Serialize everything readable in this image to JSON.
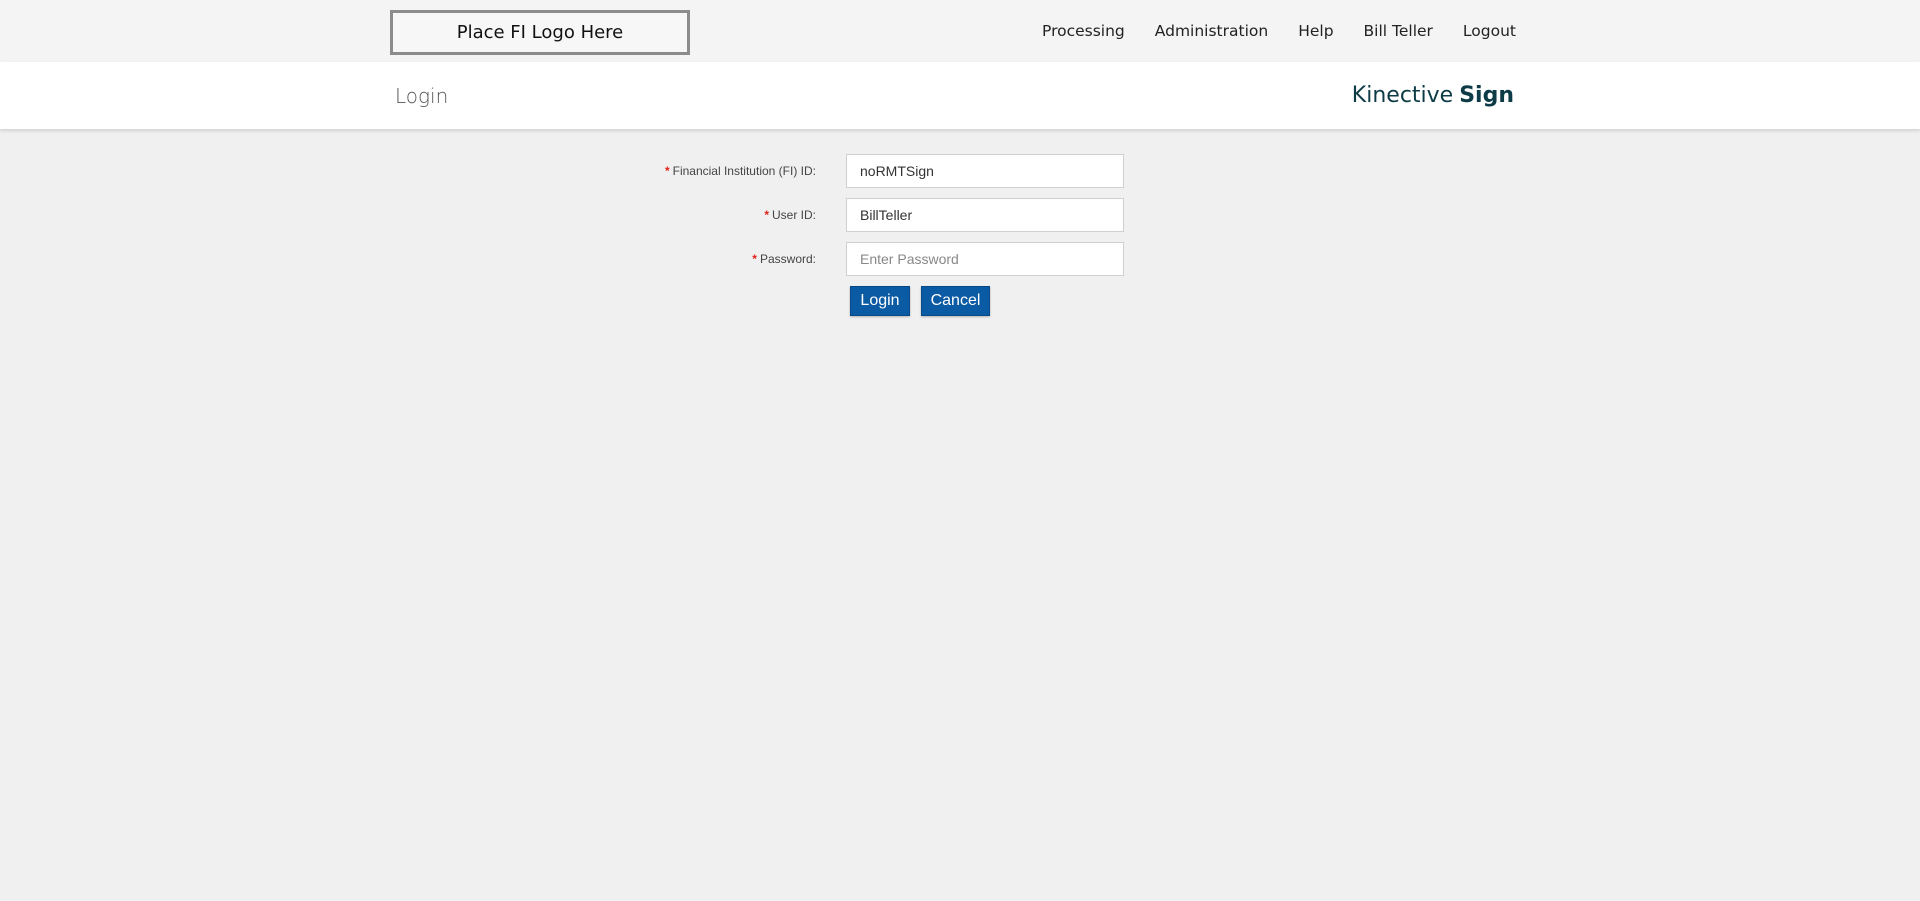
{
  "header": {
    "logo_placeholder": "Place FI Logo Here",
    "nav": [
      {
        "label": "Processing"
      },
      {
        "label": "Administration"
      },
      {
        "label": "Help"
      },
      {
        "label": "Bill Teller"
      },
      {
        "label": "Logout"
      }
    ]
  },
  "titlebar": {
    "page_title": "Login",
    "brand_prefix": "Kinective",
    "brand_suffix": "Sign"
  },
  "form": {
    "required_marker": "*",
    "fi_id": {
      "label": "Financial Institution (FI) ID:",
      "value": "noRMTSign"
    },
    "user_id": {
      "label": "User ID:",
      "value": "BillTeller"
    },
    "password": {
      "label": "Password:",
      "value": "",
      "placeholder": "Enter Password"
    },
    "login_button": "Login",
    "cancel_button": "Cancel"
  },
  "colors": {
    "button_blue": "#0a5aa4",
    "brand_dark_teal": "#0d3b46",
    "required_red": "#e0231b",
    "page_background": "#f0f0f0"
  }
}
